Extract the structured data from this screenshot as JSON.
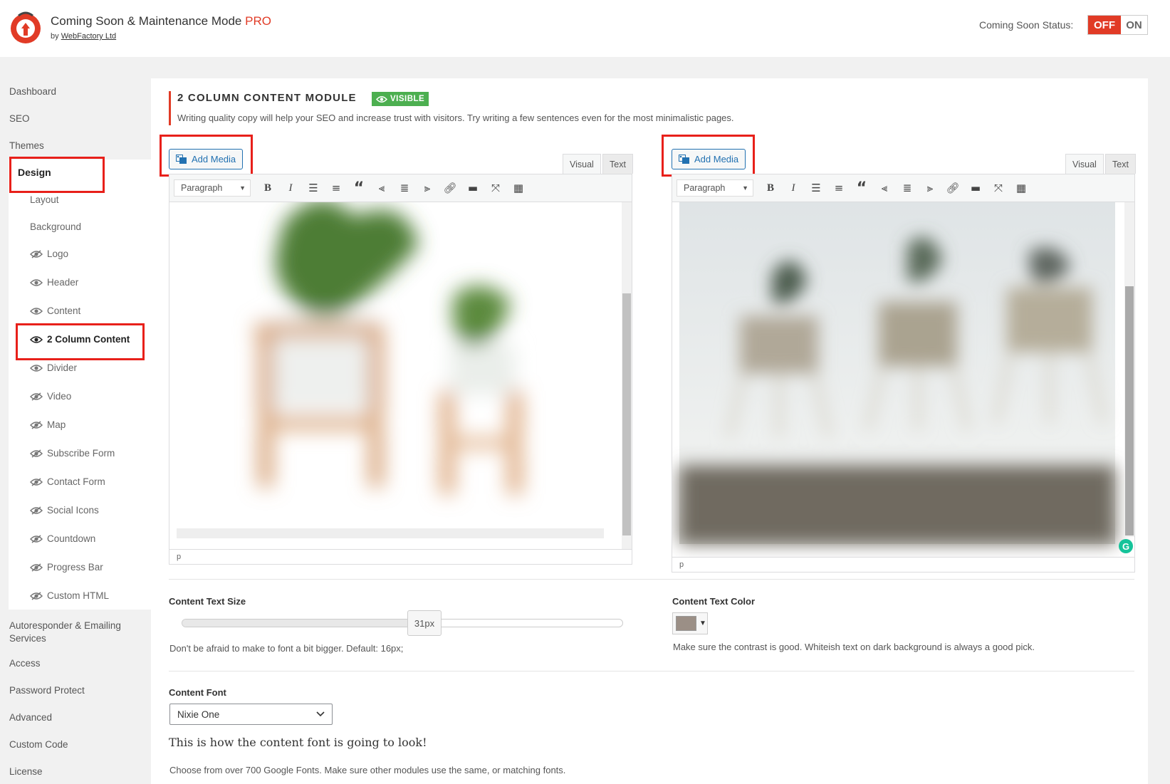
{
  "header": {
    "app_title": "Coming Soon & Maintenance Mode",
    "pro_label": "PRO",
    "by_label": "by",
    "company_link": "WebFactory Ltd",
    "status_label": "Coming Soon Status:",
    "toggle_off": "OFF",
    "toggle_on": "ON"
  },
  "sidebar": {
    "top_items": [
      "Dashboard",
      "SEO",
      "Themes"
    ],
    "design_label": "Design",
    "design_sub_plain": [
      "Layout",
      "Background"
    ],
    "design_sub_modules": [
      {
        "label": "Logo",
        "visible": false
      },
      {
        "label": "Header",
        "visible": true
      },
      {
        "label": "Content",
        "visible": true
      },
      {
        "label": "2 Column Content",
        "visible": true,
        "active": true
      },
      {
        "label": "Divider",
        "visible": true
      },
      {
        "label": "Video",
        "visible": false
      },
      {
        "label": "Map",
        "visible": false
      },
      {
        "label": "Subscribe Form",
        "visible": false
      },
      {
        "label": "Contact Form",
        "visible": false
      },
      {
        "label": "Social Icons",
        "visible": false
      },
      {
        "label": "Countdown",
        "visible": false
      },
      {
        "label": "Progress Bar",
        "visible": false
      },
      {
        "label": "Custom HTML",
        "visible": false
      }
    ],
    "bottom_items": [
      "Autoresponder & Emailing Services",
      "Access",
      "Password Protect",
      "Advanced",
      "Custom Code",
      "License"
    ]
  },
  "module": {
    "title": "2 COLUMN CONTENT MODULE",
    "badge": "VISIBLE",
    "description": "Writing quality copy will help your SEO and increase trust with visitors. Try writing a few sentences even for the most minimalistic pages."
  },
  "editor": {
    "add_media": "Add Media",
    "tab_visual": "Visual",
    "tab_text": "Text",
    "format_select": "Paragraph",
    "status_path": "p"
  },
  "content_text_size": {
    "label": "Content Text Size",
    "value": "31px",
    "fraction": 0.55,
    "help": "Don't be afraid to make to font a bit bigger. Default: 16px;"
  },
  "content_text_color": {
    "label": "Content Text Color",
    "color": "#9b8f86",
    "help": "Make sure the contrast is good. Whiteish text on dark background is always a good pick."
  },
  "content_font": {
    "label": "Content Font",
    "selected": "Nixie One",
    "preview": "This is how the content font is going to look!",
    "help": "Choose from over 700 Google Fonts. Make sure other modules use the same, or matching fonts."
  },
  "colors": {
    "accent_red": "#e13b26",
    "badge_green": "#4caf50",
    "highlight_red": "#e8201a",
    "link_blue": "#2271b1"
  }
}
